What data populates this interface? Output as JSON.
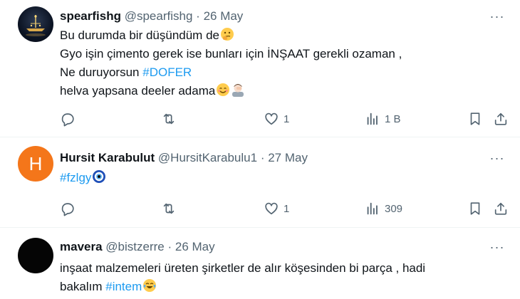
{
  "tweets": [
    {
      "name": "spearfishg",
      "handle": "@spearfishg",
      "dot": "·",
      "date": "26 May",
      "more": "···",
      "lines": [
        {
          "text": "Bu durumda bir düşündüm de"
        },
        {
          "text": "Gyo işin çimento gerek ise bunları için İNŞAAT gerekli ozaman ,"
        },
        {
          "text": "Ne duruyorsun ",
          "tag": "#DOFER"
        },
        {
          "text": "helva yapsana deeler adama"
        }
      ],
      "emojis": [
        "thinking-face-emoji",
        "smiling-face-emoji",
        "person-facepalming-emoji"
      ],
      "actions": {
        "replies": "",
        "retweets": "",
        "likes": "1",
        "views": "1 B"
      }
    },
    {
      "avatar_letter": "H",
      "name": "Hursit Karabulut",
      "handle": "@HursitKarabulu1",
      "dot": "·",
      "date": "27 May",
      "more": "···",
      "tag": "#fzlgy",
      "emojis": [
        "nazar-amulet-emoji"
      ],
      "actions": {
        "replies": "",
        "retweets": "",
        "likes": "1",
        "views": "309"
      }
    },
    {
      "name": "mavera",
      "handle": "@bistzerre",
      "dot": "·",
      "date": "26 May",
      "more": "···",
      "line1": "inşaat malzemeleri üreten şirketler de alır köşesinden bi parça , hadi",
      "line2_prefix": "bakalım ",
      "tag": "#intem",
      "emojis": [
        "face-with-tears-of-joy-emoji"
      ]
    }
  ],
  "colors": {
    "link": "#1d9bf0",
    "muted": "#536471",
    "text": "#0f1419",
    "avatar_orange": "#f4761a"
  }
}
